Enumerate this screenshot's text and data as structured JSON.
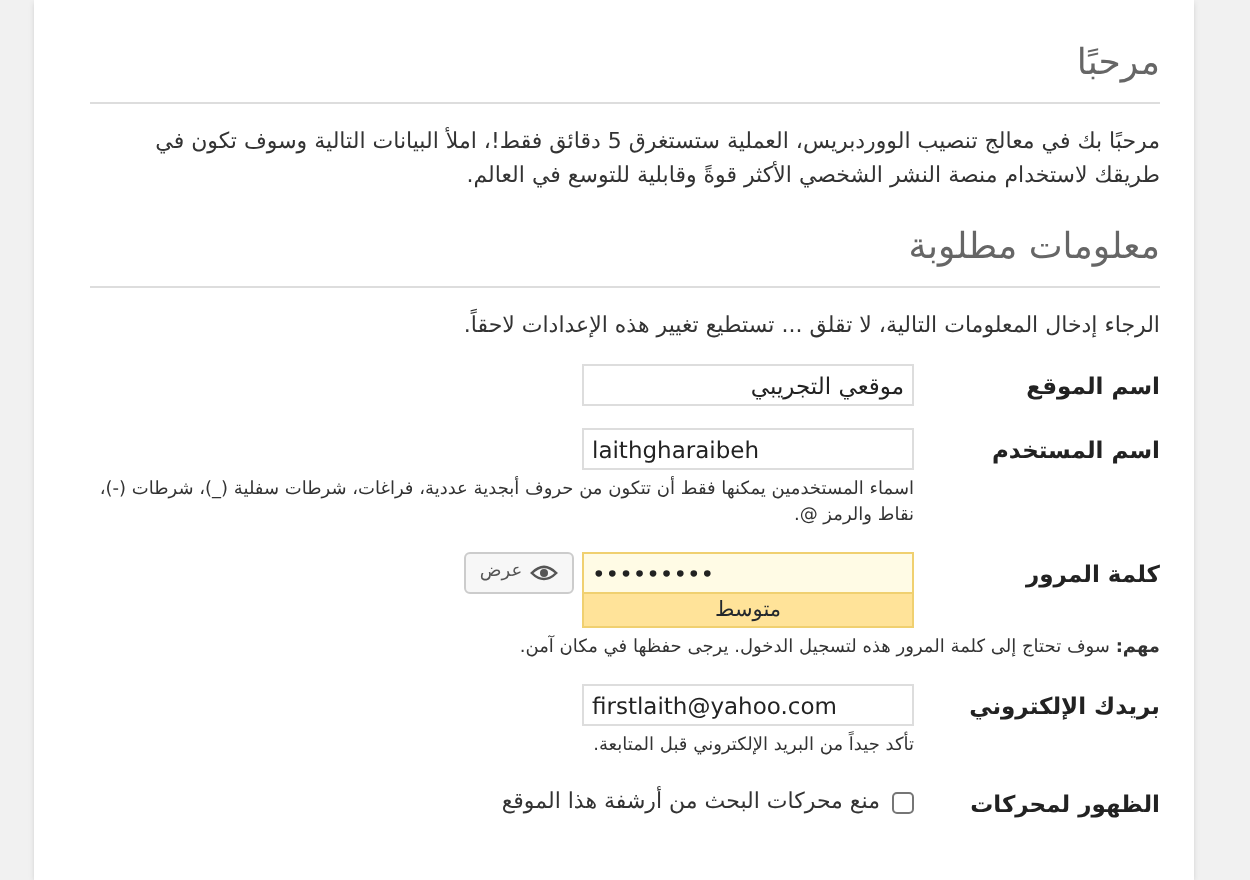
{
  "welcome": {
    "heading": "مرحبًا",
    "paragraph": "مرحبًا بك في معالج تنصيب الووردبريس، العملية ستستغرق 5 دقائق فقط!، املأ البيانات التالية وسوف تكون في طريقك لاستخدام منصة النشر الشخصي الأكثر قوةً وقابلية للتوسع في العالم."
  },
  "required": {
    "heading": "معلومات مطلوبة",
    "paragraph": "الرجاء إدخال المعلومات التالية، لا تقلق ... تستطيع تغيير هذه الإعدادات لاحقاً."
  },
  "fields": [
    {
      "kind": "text",
      "label": "اسم الموقع",
      "value": "موقعي التجريبي"
    },
    {
      "kind": "text",
      "label": "اسم المستخدم",
      "value": "laithgharaibeh",
      "hint": "اسماء المستخدمين يمكنها فقط أن تتكون من حروف أبجدية عددية، فراغات، شرطات سفلية (_)، شرطات (-)، نقاط والرمز @."
    },
    {
      "kind": "password",
      "label": "كلمة المرور",
      "value": "•••••••••",
      "show_button": "عرض",
      "strength": "متوسط",
      "hint": "**مهم:** سوف تحتاج إلى كلمة المرور هذه لتسجيل الدخول. يرجى حفظها في مكان آمن."
    },
    {
      "kind": "text",
      "label": "بريدك الإلكتروني",
      "value": "firstlaith@yahoo.com",
      "hint": "تأكد جيداً من البريد الإلكتروني قبل المتابعة."
    },
    {
      "kind": "checkbox",
      "label": "الظهور لمحركات",
      "option": "منع محركات البحث من أرشفة هذا الموقع",
      "checked": false
    }
  ]
}
